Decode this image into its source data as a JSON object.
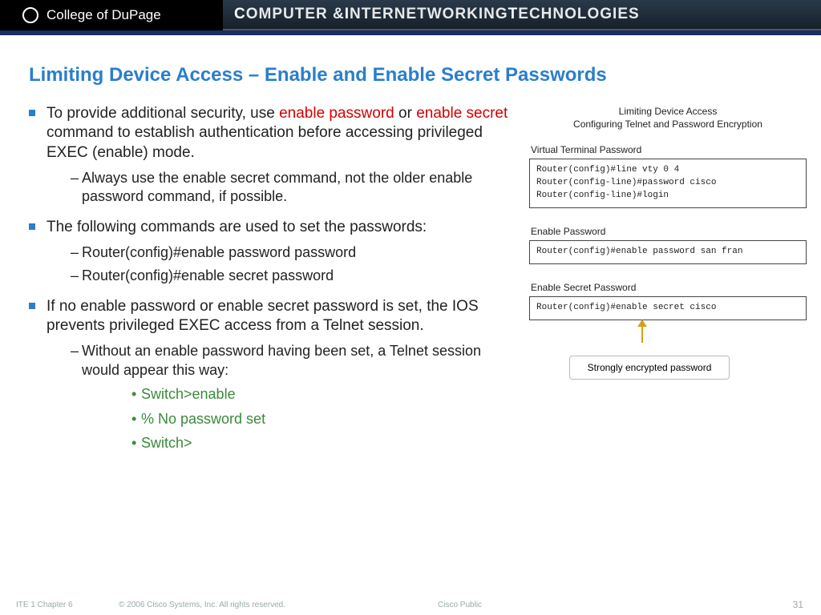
{
  "header": {
    "org": "College of DuPage",
    "banner_pre": "C",
    "banner_mid1": "OMPUTER & ",
    "banner_em": "I",
    "banner_mid2": "NTERNETWORKING ",
    "banner_em2": "T",
    "banner_end": "ECHNOLOGIES"
  },
  "title": "Limiting Device Access – Enable and Enable Secret Passwords",
  "bullets": {
    "b1_p1": "To provide additional security, use ",
    "b1_hl1": "enable password",
    "b1_p2": " or ",
    "b1_hl2": "enable secret",
    "b1_p3": " command to establish authentication before accessing privileged EXEC (enable) mode.",
    "b1_sub1": "Always use the enable secret command, not the older enable password command, if possible.",
    "b2": "The following commands are used to set the passwords:",
    "b2_sub1": "Router(config)#enable password password",
    "b2_sub2": "Router(config)#enable secret password",
    "b3": "If no enable password or enable secret password is set, the IOS prevents privileged EXEC access from a Telnet session.",
    "b3_sub1": "Without an enable password having been set, a Telnet session would appear this way:",
    "b3_s1": "Switch>enable",
    "b3_s2": "% No password set",
    "b3_s3": "Switch>"
  },
  "diagram": {
    "title": "Limiting Device Access",
    "subtitle": "Configuring Telnet and Password Encryption",
    "sec1_label": "Virtual Terminal Password",
    "sec1_code": "Router(config)#line vty 0 4\nRouter(config-line)#password cisco\nRouter(config-line)#login",
    "sec2_label": "Enable Password",
    "sec2_code": "Router(config)#enable password san fran",
    "sec3_label": "Enable Secret Password",
    "sec3_code": "Router(config)#enable secret cisco",
    "callout": "Strongly encrypted password"
  },
  "footer": {
    "left": "ITE 1 Chapter 6",
    "copyright": "© 2006 Cisco Systems, Inc. All rights reserved.",
    "public": "Cisco Public",
    "page": "31"
  }
}
